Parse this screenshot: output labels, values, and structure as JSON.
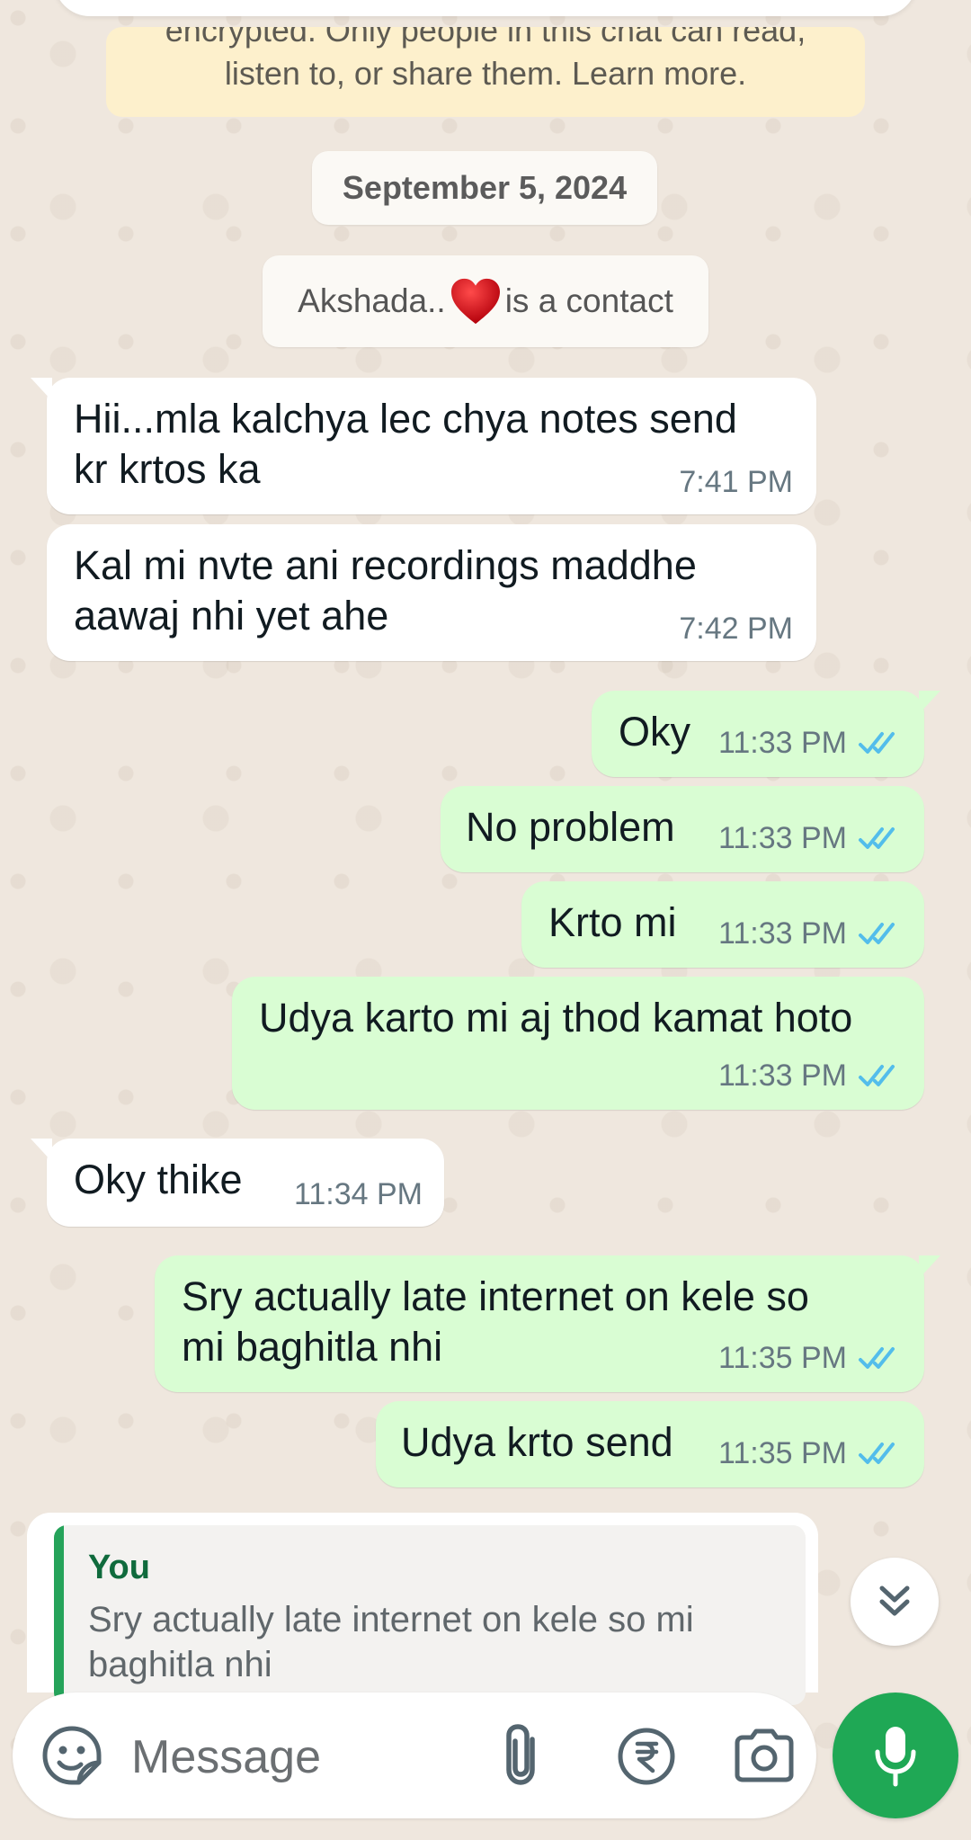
{
  "chat": {
    "encryption_notice": {
      "line1": "encrypted. Only people in this chat can read,",
      "line2": "listen to, or share them. Learn more."
    },
    "date_separator": "September 5, 2024",
    "contact_notice": {
      "name": "Akshada..",
      "emoji": "red-heart",
      "suffix": "is a contact"
    },
    "messages": [
      {
        "direction": "incoming",
        "line1": "Hii...mla kalchya lec chya notes send",
        "line2": "kr krtos ka",
        "time": "7:41 PM"
      },
      {
        "direction": "incoming",
        "line1": "Kal mi nvte ani recordings maddhe",
        "line2": "aawaj nhi yet ahe",
        "time": "7:42 PM"
      },
      {
        "direction": "outgoing",
        "text": "Oky",
        "time": "11:33 PM",
        "status": "read"
      },
      {
        "direction": "outgoing",
        "text": "No problem",
        "time": "11:33 PM",
        "status": "read"
      },
      {
        "direction": "outgoing",
        "text": "Krto mi",
        "time": "11:33 PM",
        "status": "read"
      },
      {
        "direction": "outgoing",
        "text": "Udya karto mi aj thod kamat hoto",
        "time": "11:33 PM",
        "status": "read"
      },
      {
        "direction": "incoming",
        "text": "Oky thike",
        "time": "11:34 PM"
      },
      {
        "direction": "outgoing",
        "line1": "Sry actually late internet on kele so",
        "line2": "mi baghitla nhi",
        "time": "11:35 PM",
        "status": "read"
      },
      {
        "direction": "outgoing",
        "text": "Udya krto send",
        "time": "11:35 PM",
        "status": "read"
      }
    ]
  },
  "reply_preview": {
    "author": "You",
    "line1": "Sry actually late internet on kele so mi",
    "line2": "baghitla nhi"
  },
  "composer": {
    "placeholder": "Message",
    "icons": [
      "sticker-icon",
      "paperclip-icon",
      "rupee-payment-icon",
      "camera-icon",
      "microphone-icon"
    ]
  },
  "colors": {
    "outgoing_bubble": "#d9fdd3",
    "incoming_bubble": "#ffffff",
    "read_ticks": "#53bdeb",
    "mic_button": "#1fa855",
    "reply_accent": "#25a35a"
  }
}
